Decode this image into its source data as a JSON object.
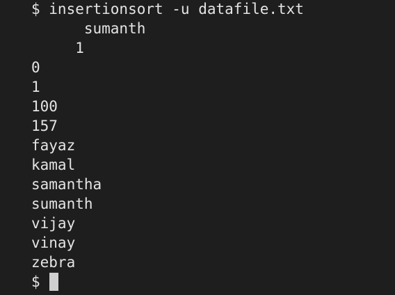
{
  "terminal": {
    "command_line": "$ insertionsort -u datafile.txt",
    "output_lines": [
      "      sumanth",
      "     1",
      "0",
      "1",
      "100",
      "157",
      "fayaz",
      "kamal",
      "samantha",
      "sumanth",
      "vijay",
      "vinay",
      "zebra"
    ],
    "prompt": "$",
    "colors": {
      "background": "#1e1e1e",
      "text": "#e4e4e4",
      "cursor": "#cfcfcf"
    }
  }
}
